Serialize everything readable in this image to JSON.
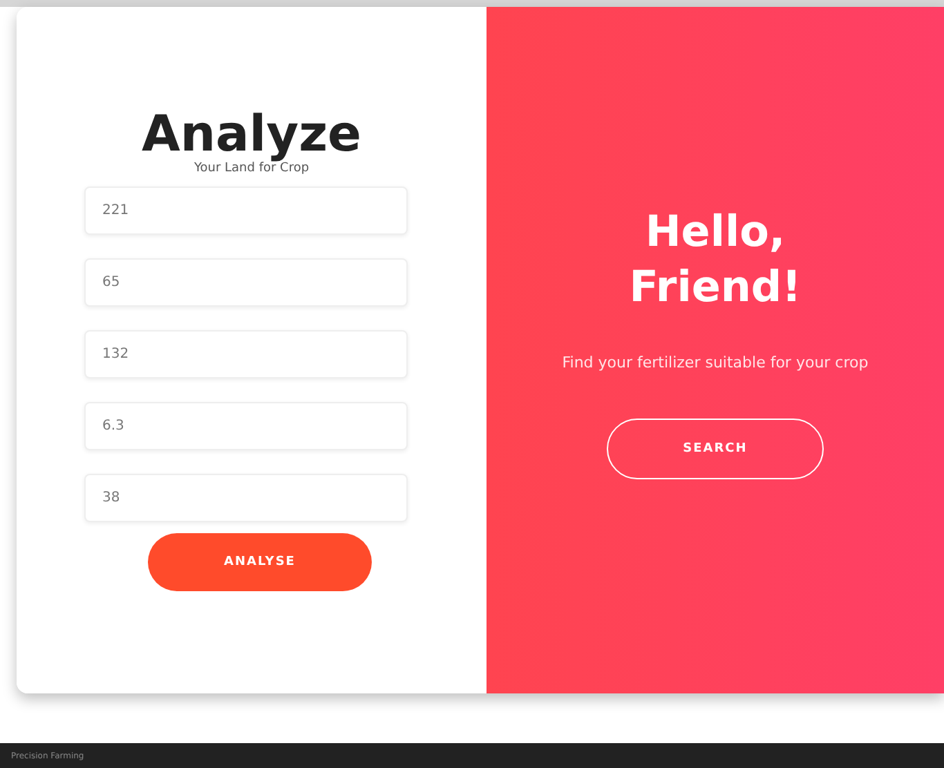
{
  "analyze_panel": {
    "title": "Analyze",
    "subtitle": "Your Land for Crop",
    "fields": [
      {
        "value": "221"
      },
      {
        "value": "65"
      },
      {
        "value": "132"
      },
      {
        "value": "6.3"
      },
      {
        "value": "38"
      }
    ],
    "button": "ANALYSE"
  },
  "overlay_panel": {
    "title_lines": [
      "Hello,",
      "Friend!"
    ],
    "text": "Find your fertilizer suitable for your crop",
    "button": "SEARCH"
  },
  "taskbar": {
    "label": "Precision Farming"
  }
}
